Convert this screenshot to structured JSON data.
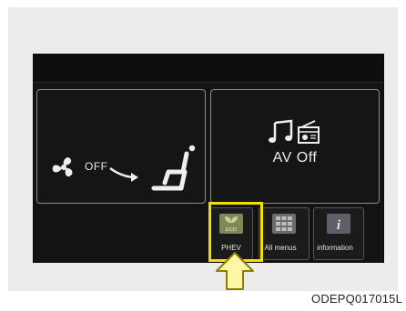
{
  "climate": {
    "fan_status": "OFF"
  },
  "av": {
    "status": "AV Off"
  },
  "bottom_buttons": {
    "eco_icon_text": "ECO",
    "eco_label": "PHEV",
    "all_menus_label": "All menus",
    "information_icon_text": "i",
    "information_label": "information"
  },
  "figure_code": "ODEPQ017015L",
  "colors": {
    "screen_bg": "#131313",
    "highlight": "#f2e100",
    "eco_icon": "#7e8a55"
  },
  "icons": [
    "fan-icon",
    "airflow-seat-icon",
    "music-note-icon",
    "radio-icon",
    "eco-icon",
    "grid-icon",
    "info-icon",
    "up-arrow-icon"
  ]
}
